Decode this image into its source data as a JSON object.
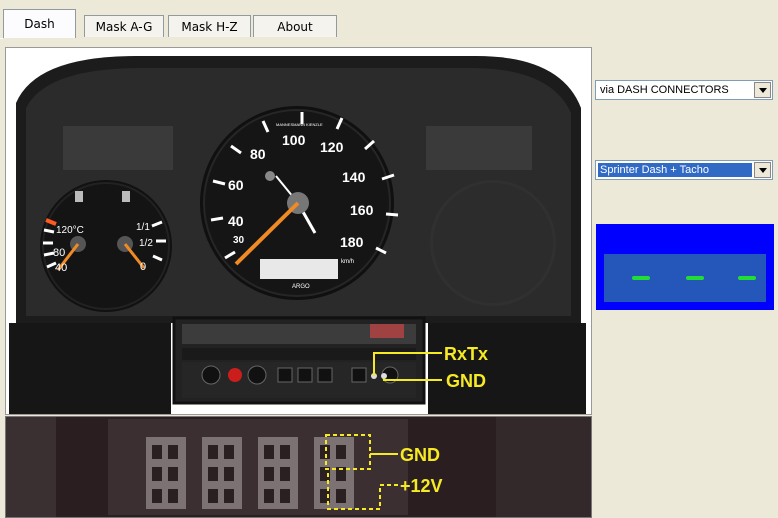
{
  "tabs": [
    {
      "label": "Dash",
      "active": true
    },
    {
      "label": "Mask  A-G",
      "active": false
    },
    {
      "label": "Mask  H-Z",
      "active": false
    },
    {
      "label": "About",
      "active": false
    }
  ],
  "dash_photo": {
    "speedo_brand": "MANNESMANN\nKIENZLE",
    "speed_ticks": [
      "30",
      "40",
      "60",
      "80",
      "100",
      "120",
      "140",
      "160",
      "180"
    ],
    "speed_unit": "km/h",
    "temp_label": "120°C",
    "temp_ticks": [
      "80",
      "40"
    ],
    "fuel_ticks": [
      "1/1",
      "1/2",
      "0"
    ],
    "maker_mark": "ARGO",
    "callouts": {
      "rxtx": "RxTx",
      "gnd_top": "GND"
    }
  },
  "connector_photo": {
    "callouts": {
      "gnd": "GND",
      "plus12v": "+12V"
    }
  },
  "controls": {
    "connection_source": "via DASH CONNECTORS",
    "dash_model": "Sprinter  Dash + Tacho"
  },
  "status": {
    "led_color": "#22dd33",
    "panel_color": "#0000ff",
    "led_count": 3
  }
}
